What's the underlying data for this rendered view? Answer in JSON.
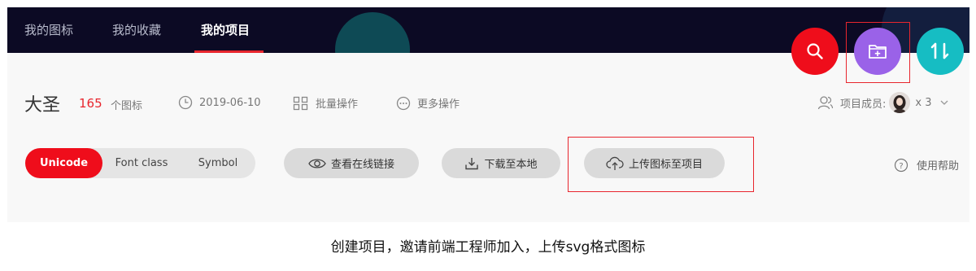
{
  "nav": {
    "items": [
      {
        "label": "我的图标"
      },
      {
        "label": "我的收藏"
      },
      {
        "label": "我的项目"
      }
    ]
  },
  "fabs": {
    "search_icon": "search-icon",
    "add_icon": "add-folder-icon",
    "sort_icon": "sort-icon"
  },
  "project": {
    "name": "大圣",
    "icon_count": "165",
    "icon_count_unit": "个图标",
    "date": "2019-06-10",
    "batch_label": "批量操作",
    "more_label": "更多操作",
    "members_label": "项目成员:",
    "members_count": "x 3"
  },
  "toolbar": {
    "tabs": [
      {
        "label": "Unicode",
        "active": true
      },
      {
        "label": "Font class"
      },
      {
        "label": "Symbol"
      }
    ],
    "view_link_label": "查看在线链接",
    "download_label": "下载至本地",
    "upload_label": "上传图标至项目",
    "help_label": "使用帮助"
  },
  "caption": "创建项目，邀请前端工程师加入，上传svg格式图标",
  "colors": {
    "accent_red": "#ef0d1b",
    "purple": "#9a62e8",
    "teal": "#16bdc3",
    "nav_bg": "#0c0a24"
  }
}
